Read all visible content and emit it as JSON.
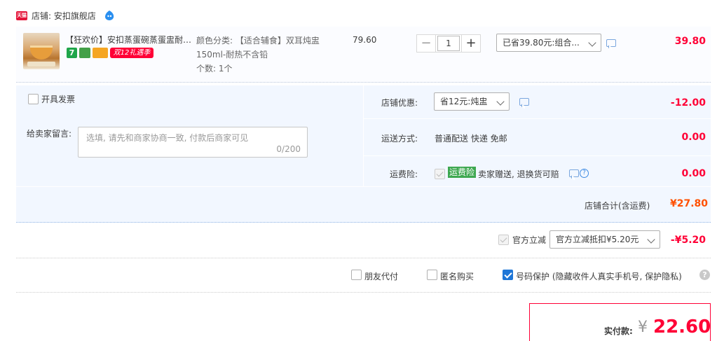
{
  "shop": {
    "label": "店铺: 安扣旗舰店",
    "logo_text": "天猫"
  },
  "item": {
    "title": "【狂欢价】安扣蒸蛋碗蒸蛋盅耐热玻璃炖盅",
    "badges": [
      "7",
      "",
      "",
      "双12礼遇季"
    ],
    "sku_line1": "颜色分类: 【适合辅食】双耳炖盅",
    "sku_line2": "150ml-耐热不含铅",
    "count": "个数: 1个",
    "price": "79.60",
    "quantity": "1",
    "minus": "−",
    "plus": "+",
    "promo_select": "已省39.80元:组合...",
    "subtotal": "39.80"
  },
  "options": {
    "invoice_label": "开具发票",
    "memo_label": "给卖家留言:",
    "memo_placeholder": "选填, 请先和商家协商一致, 付款后商家可见",
    "memo_count": "0/200",
    "discount_label": "店铺优惠:",
    "discount_select": "省12元:炖盅",
    "discount_amount": "-12.00",
    "shipping_label": "运送方式:",
    "shipping_value": "普通配送 快递 免邮",
    "shipping_amount": "0.00",
    "insurance_label": "运费险:",
    "insurance_tag": "运费险",
    "insurance_text": "卖家赠送, 退换货可赔",
    "insurance_help": "?",
    "insurance_amount": "0.00"
  },
  "shop_total": {
    "label": "店铺合计(含运费)",
    "value": "¥27.80"
  },
  "official": {
    "label": "官方立减",
    "select": "官方立减抵扣¥5.20元",
    "amount": "-¥5.20"
  },
  "extras": {
    "friend_pay": "朋友代付",
    "anonymous": "匿名购买",
    "number_protect": "号码保护 (隐藏收件人真实手机号, 保护隐私)",
    "help": "?"
  },
  "payment": {
    "label": "实付款:",
    "symbol": "¥",
    "value": "22.60"
  },
  "colors": {
    "accent_red": "#ff0036",
    "total_orange": "#ff5000",
    "panel_blue": "#f2f7ff",
    "check_blue": "#1e76d7"
  }
}
